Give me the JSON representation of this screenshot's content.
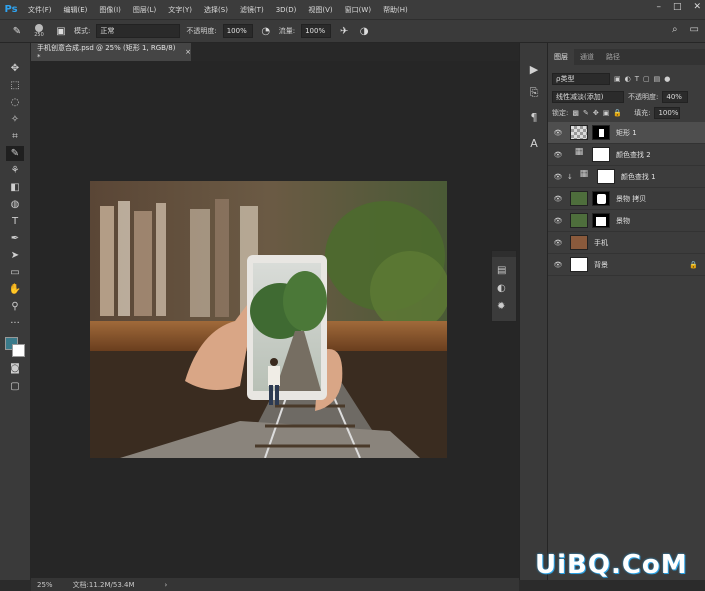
{
  "app": {
    "logo": "Ps"
  },
  "menu": [
    "文件(F)",
    "编辑(E)",
    "图像(I)",
    "图层(L)",
    "文字(Y)",
    "选择(S)",
    "滤镜(T)",
    "3D(D)",
    "视图(V)",
    "窗口(W)",
    "帮助(H)"
  ],
  "options": {
    "brush_size": "250",
    "mode_label": "模式:",
    "mode_value": "正常",
    "opacity_label": "不透明度:",
    "opacity_value": "100%",
    "flow_label": "流量:",
    "flow_value": "100%"
  },
  "document": {
    "tab_title": "手机创意合成.psd @ 25% (矩形 1, RGB/8) *",
    "zoom": "25%",
    "doc_size": "文档:11.2M/53.4M"
  },
  "layers_panel": {
    "tabs": [
      "图层",
      "通道",
      "路径"
    ],
    "filter_label": "ρ类型",
    "blend_mode": "线性减淡(添加)",
    "opacity_label": "不透明度:",
    "opacity_value": "40%",
    "lock_label": "锁定:",
    "fill_label": "填充:",
    "fill_value": "100%",
    "layers": [
      {
        "name": "矩形 1",
        "selected": true
      },
      {
        "name": "颜色查找 2",
        "selected": false
      },
      {
        "name": "颜色查找 1",
        "selected": false
      },
      {
        "name": "景物 拷贝",
        "selected": false
      },
      {
        "name": "景物",
        "selected": false
      },
      {
        "name": "手机",
        "selected": false
      },
      {
        "name": "背景",
        "selected": false
      }
    ]
  },
  "watermark": "UiBQ.CoM",
  "colors": {
    "accent": "#2fa3f0",
    "foreground": "#3a7a8a",
    "background": "#ffffff"
  }
}
